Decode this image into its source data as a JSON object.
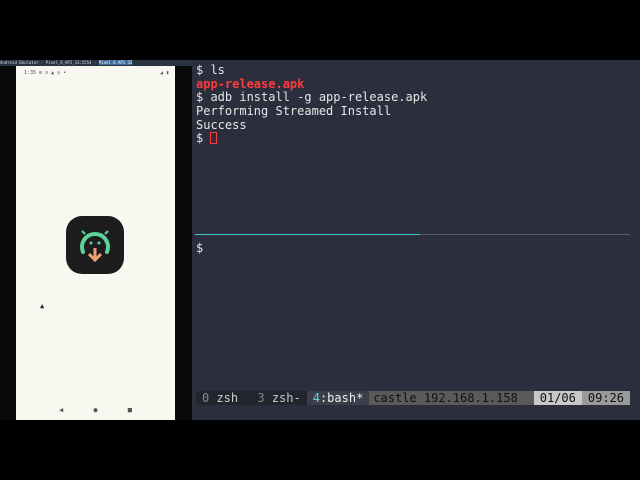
{
  "emulator": {
    "title": "Android Emulator - Pixel_6_API_33:5554",
    "title_highlight": "Pixel 6 API 33",
    "status_time": "1:35",
    "status_icons": "⚙ ≡ ▲ ◎ •",
    "battery": "◢ ▮",
    "nav": {
      "back": "◀",
      "home": "●",
      "recents": "■"
    }
  },
  "terminal": {
    "top_pane": [
      {
        "prompt": "$ ",
        "cmd": "ls"
      },
      {
        "output": "app-release.apk",
        "style": "red"
      },
      {
        "prompt": "$ ",
        "cmd": "adb install -g app-release.apk"
      },
      {
        "output": "Performing Streamed Install"
      },
      {
        "output": "Success"
      },
      {
        "prompt": "$ ",
        "cmd": ""
      }
    ],
    "bottom_pane": {
      "prompt": "$"
    }
  },
  "tmux": {
    "windows": [
      {
        "num": "0",
        "name": " zsh "
      },
      {
        "num": "3",
        "name": " zsh-"
      },
      {
        "num": "4",
        "name": ":bash*"
      }
    ],
    "host": "castle 192.168.1.158",
    "date": "01/06",
    "time": "09:26"
  },
  "colors": {
    "terminal_bg": "#2b2e3c",
    "accent": "#3ec6c6",
    "error": "#ff3b3b",
    "icon_green": "#5fd49a",
    "icon_orange": "#f0a070"
  }
}
